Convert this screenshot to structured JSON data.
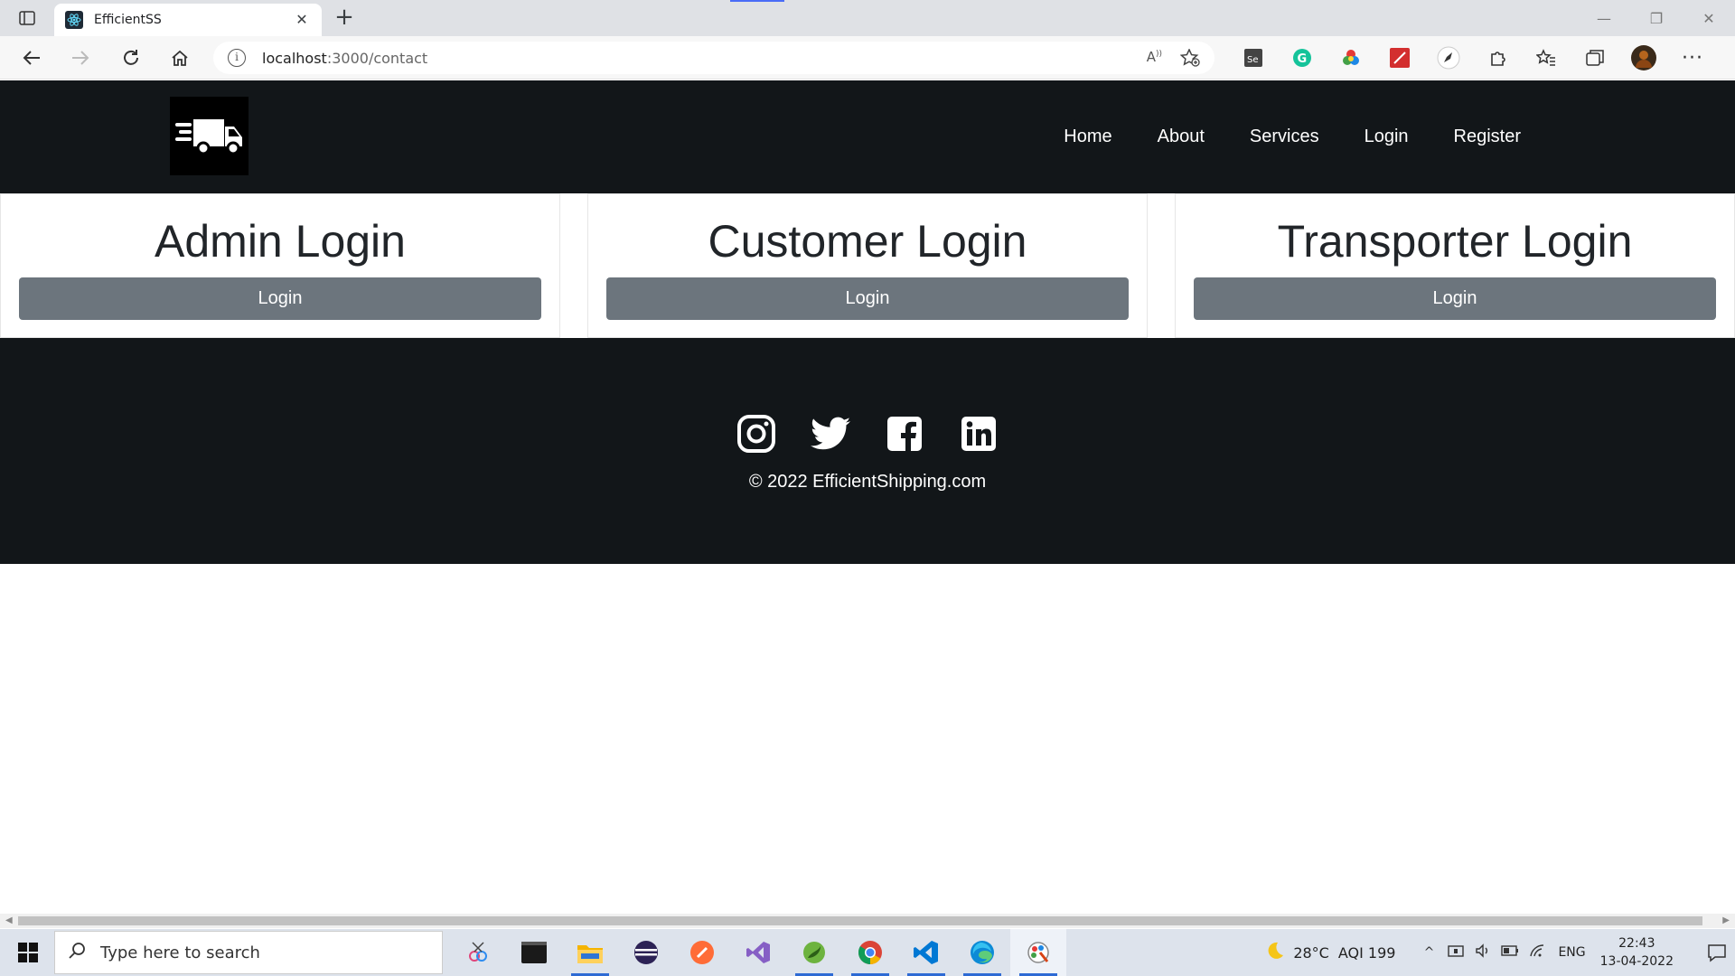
{
  "browser": {
    "tab_title": "EfficientSS",
    "url_host": "localhost",
    "url_path": ":3000/contact"
  },
  "site": {
    "nav": [
      "Home",
      "About",
      "Services",
      "Login",
      "Register"
    ],
    "cards": [
      {
        "title": "Admin Login",
        "button": "Login"
      },
      {
        "title": "Customer Login",
        "button": "Login"
      },
      {
        "title": "Transporter Login",
        "button": "Login"
      }
    ],
    "footer": {
      "socials": [
        "instagram-icon",
        "twitter-icon",
        "facebook-icon",
        "linkedin-icon"
      ],
      "copyright": "© 2022 EfficientShipping.com"
    },
    "colors": {
      "header_bg": "#121619",
      "button_bg": "#6c757d"
    }
  },
  "taskbar": {
    "search_placeholder": "Type here to search",
    "weather_temp": "28°C",
    "weather_aqi": "AQI 199",
    "language": "ENG",
    "time": "22:43",
    "date": "13-04-2022"
  }
}
